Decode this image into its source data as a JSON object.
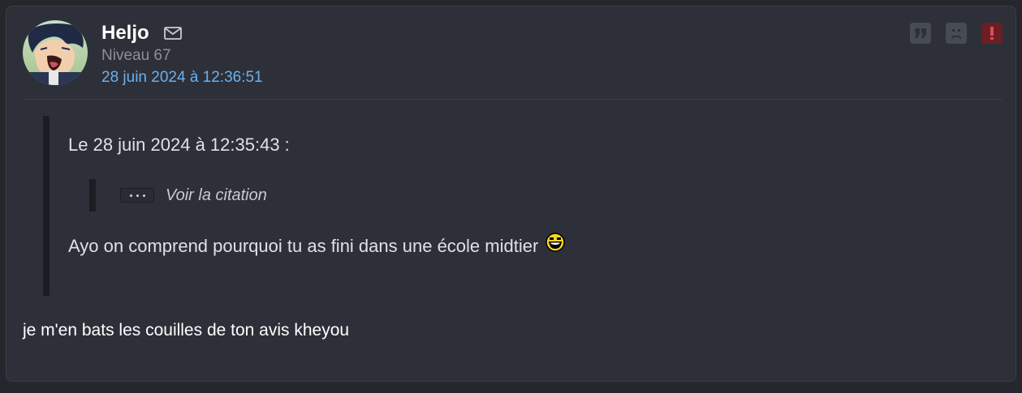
{
  "post": {
    "author": {
      "username": "Heljo",
      "level": "Niveau 67",
      "date": "28 juin 2024 à 12:36:51",
      "avatar_icon": "avatar-anime-character",
      "mail_icon": "mail-icon"
    },
    "actions": [
      {
        "name": "quote-button",
        "icon": "quote-icon"
      },
      {
        "name": "blacklist-button",
        "icon": "sad-face-icon"
      },
      {
        "name": "report-button",
        "icon": "exclamation-icon",
        "color": "#6b1e24"
      }
    ],
    "quote": {
      "header": "Le 28 juin 2024 à 12:35:43 :",
      "nested_label": "Voir la citation",
      "body": "Ayo on comprend pourquoi tu as fini dans une école midtier",
      "smiley_icon": "laughing-smiley-icon"
    },
    "reply": "je m'en bats les couilles de ton avis kheyou"
  },
  "colors": {
    "background": "#25272c",
    "card": "#2d3038",
    "date_link": "#6ab0ef",
    "quote_border": "#1c1d22"
  }
}
